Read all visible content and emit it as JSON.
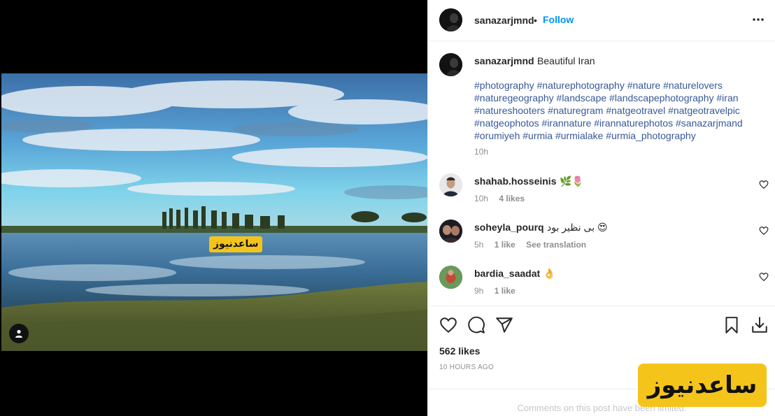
{
  "post": {
    "username": "sanazarjmnd",
    "separator": "•",
    "follow_label": "Follow",
    "watermark_small": "ساعدنیوز",
    "watermark_big": "ساعدنیوز"
  },
  "caption": {
    "username": "sanazarjmnd",
    "text": "Beautiful Iran",
    "hashtags": "#photography #naturephotography #nature #naturelovers #naturegeography #landscape #landscapephotography #iran #natureshooters #naturegram #natgeotravel #natgeotravelpic #natgeophotos #irannature #irannaturephotos #sanazarjmand #orumiyeh #urmia #urmialake #urmia_photography",
    "time": "10h"
  },
  "comments": [
    {
      "username": "shahab.hosseinis",
      "text": "🌿🌷",
      "time": "10h",
      "likes": "4 likes",
      "translate": ""
    },
    {
      "username": "soheyla_pourq",
      "text": "بی نظیر بود 😍",
      "time": "5h",
      "likes": "1 like",
      "translate": "See translation"
    },
    {
      "username": "bardia_saadat",
      "text": "👌",
      "time": "9h",
      "likes": "1 like",
      "translate": ""
    }
  ],
  "stats": {
    "likes": "562 likes",
    "ago": "10 HOURS AGO"
  },
  "footer": {
    "limited": "Comments on this post have been limited."
  },
  "icons": {
    "more": "more-options-icon",
    "like": "heart-icon",
    "comment": "comment-icon",
    "share": "share-icon",
    "save": "bookmark-icon",
    "download": "download-icon"
  },
  "colors": {
    "follow": "#0095f6",
    "hashtag": "#385898",
    "watermark": "#f5c41a"
  }
}
